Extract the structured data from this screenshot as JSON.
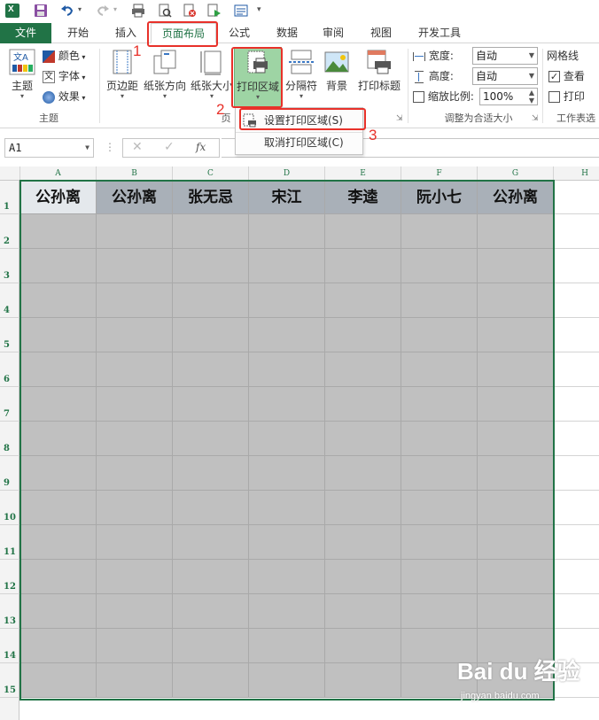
{
  "tabs": [
    {
      "label": "文件"
    },
    {
      "label": "开始"
    },
    {
      "label": "插入"
    },
    {
      "label": "页面布局"
    },
    {
      "label": "公式"
    },
    {
      "label": "数据"
    },
    {
      "label": "审阅"
    },
    {
      "label": "视图"
    },
    {
      "label": "开发工具"
    }
  ],
  "ribbon": {
    "theme_group": {
      "themes_label": "主题",
      "colors_label": "颜色",
      "fonts_label": "字体",
      "effects_label": "效果",
      "group_label": "主题"
    },
    "page_setup": {
      "margins_label": "页边距",
      "orientation_label": "纸张方向",
      "size_label": "纸张大小",
      "print_area_label": "打印区域",
      "breaks_label": "分隔符",
      "background_label": "背景",
      "print_titles_label": "打印标题",
      "group_label_partial": "页"
    },
    "scale_to_fit": {
      "width_label": "宽度:",
      "width_value": "自动",
      "height_label": "高度:",
      "height_value": "自动",
      "scale_label": "缩放比例:",
      "scale_value": "100%",
      "group_label": "调整为合适大小"
    },
    "sheet_options": {
      "gridlines_label": "网格线",
      "view_label": "查看",
      "view_checked": true,
      "print_label": "打印",
      "print_checked": false,
      "group_label_partial": "工作表选"
    }
  },
  "print_area_menu": {
    "set_label": "设置打印区域(S)",
    "clear_label": "取消打印区域(C)"
  },
  "formula_bar": {
    "name_box": "A1",
    "fx_label": "fx",
    "formula": ""
  },
  "sheet": {
    "columns": [
      "A",
      "B",
      "C",
      "D",
      "E",
      "F",
      "G",
      "H"
    ],
    "rows": [
      "1",
      "2",
      "3",
      "4",
      "5",
      "6",
      "7",
      "8",
      "9",
      "10",
      "11",
      "12",
      "13",
      "14",
      "15"
    ],
    "header_row": [
      "公孙离",
      "公孙离",
      "张无忌",
      "宋江",
      "李逵",
      "阮小七",
      "公孙离"
    ]
  },
  "callouts": [
    "1",
    "2",
    "3"
  ],
  "watermark": {
    "logo": "Bai du 经验",
    "url": "jingyan.baidu.com"
  },
  "colors": {
    "excel_green": "#217346",
    "callout_red": "#e8312a",
    "print_area_fill": "#c0c0c0",
    "header_fill": "#a9b0b8"
  }
}
